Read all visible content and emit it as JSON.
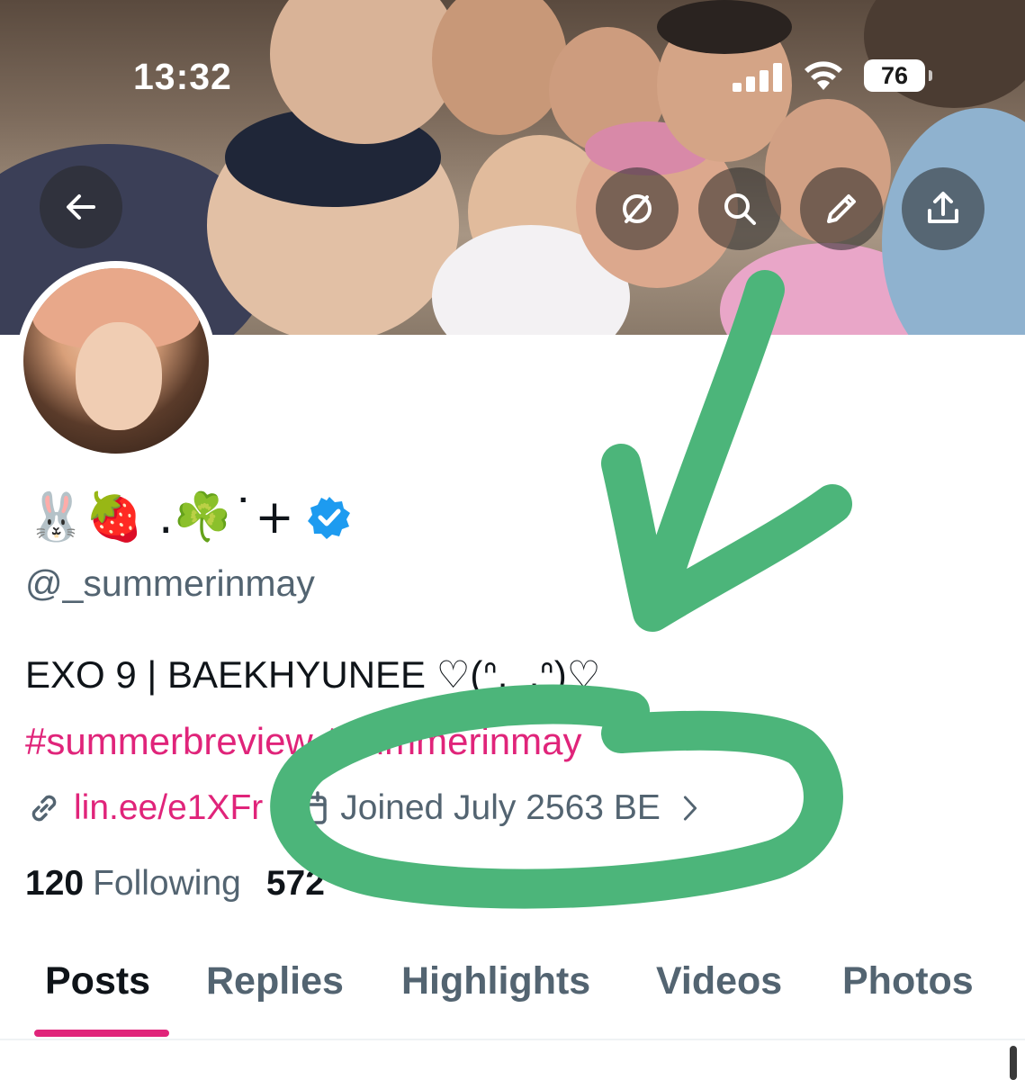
{
  "status_bar": {
    "time": "13:32",
    "battery": "76",
    "icons": [
      "signal-icon",
      "wifi-icon",
      "battery-icon"
    ]
  },
  "header_actions": {
    "back_icon": "arrow-left-icon",
    "icons": [
      "no-grok-icon",
      "search-icon",
      "edit-icon",
      "share-icon"
    ]
  },
  "profile": {
    "display_name": "🐰🍓 .☘️˙+",
    "verified": true,
    "handle": "@_summerinmay",
    "bio": "EXO 9 | BAEKHYUNEE ♡(ᐢ._.ᐢ)♡",
    "hashtags": "#summerbreview #summerinmay",
    "link": "lin.ee/e1XFr",
    "joined": "Joined July 2563 BE",
    "following_count": "120",
    "following_label": "Following",
    "followers_count": "572"
  },
  "tabs": [
    "Posts",
    "Replies",
    "Highlights",
    "Videos",
    "Photos"
  ],
  "active_tab": "Posts",
  "colors": {
    "accent": "#e0247a",
    "verified": "#1d9bf0",
    "muted_text": "#536471",
    "annotation": "#4cb57a"
  }
}
